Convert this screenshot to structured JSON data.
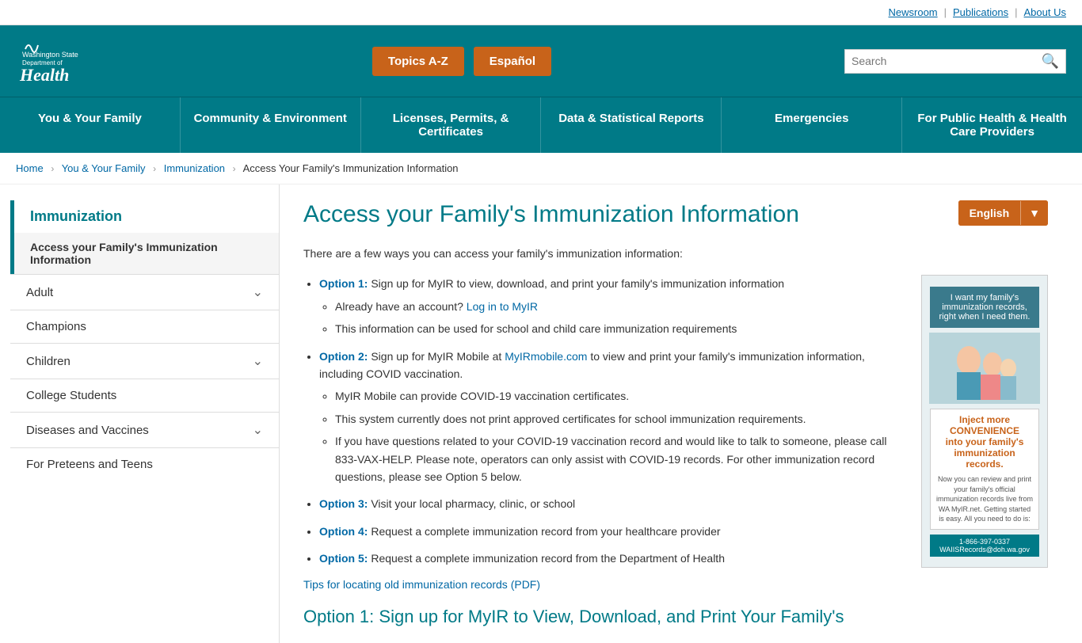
{
  "header": {
    "top_links": [
      {
        "label": "Newsroom",
        "id": "newsroom"
      },
      {
        "label": "Publications",
        "id": "publications"
      },
      {
        "label": "About Us",
        "id": "about-us"
      }
    ],
    "btn_topics": "Topics A-Z",
    "btn_espanol": "Español",
    "search_placeholder": "Search"
  },
  "nav": {
    "items": [
      {
        "label": "You & Your Family",
        "id": "you-your-family"
      },
      {
        "label": "Community & Environment",
        "id": "community-environment"
      },
      {
        "label": "Licenses, Permits, & Certificates",
        "id": "licenses-permits"
      },
      {
        "label": "Data & Statistical Reports",
        "id": "data-statistical"
      },
      {
        "label": "Emergencies",
        "id": "emergencies"
      },
      {
        "label": "For Public Health & Health Care Providers",
        "id": "public-health"
      }
    ]
  },
  "breadcrumb": {
    "items": [
      {
        "label": "Home",
        "id": "home"
      },
      {
        "label": "You & Your Family",
        "id": "you-your-family"
      },
      {
        "label": "Immunization",
        "id": "immunization"
      }
    ],
    "current": "Access Your Family's Immunization Information"
  },
  "sidebar": {
    "title": "Immunization",
    "active_item": "Access your Family's Immunization Information",
    "items": [
      {
        "label": "Adult",
        "has_chevron": true,
        "id": "adult"
      },
      {
        "label": "Champions",
        "has_chevron": false,
        "id": "champions"
      },
      {
        "label": "Children",
        "has_chevron": true,
        "id": "children"
      },
      {
        "label": "College Students",
        "has_chevron": false,
        "id": "college-students"
      },
      {
        "label": "Diseases and Vaccines",
        "has_chevron": true,
        "id": "diseases-vaccines"
      },
      {
        "label": "For Preteens and Teens",
        "has_chevron": false,
        "id": "preteens-teens"
      }
    ]
  },
  "main": {
    "page_title": "Access your Family's Immunization Information",
    "lang_button": "English",
    "intro": "There are a few ways you can access your family's immunization information:",
    "options": [
      {
        "label": "Option 1:",
        "text": " Sign up for MyIR to view, download, and print your family's immunization information",
        "sub_items": [
          {
            "text": "Already have an account? ",
            "link_label": "Log in to MyIR",
            "link": "#"
          },
          {
            "text": "This information can be used for school and child care immunization requirements"
          }
        ]
      },
      {
        "label": "Option 2:",
        "text": " Sign up for MyIR Mobile at ",
        "link_label": "MyIRmobile.com",
        "link": "#",
        "text2": " to view and print your family's immunization information, including COVID vaccination.",
        "sub_items": [
          {
            "text": "MyIR Mobile can provide COVID-19 vaccination certificates."
          },
          {
            "text": "This system currently does not print approved certificates for school immunization requirements."
          },
          {
            "text": "If you have questions related to your COVID-19 vaccination record and would like to talk to someone, please call 833-VAX-HELP. Please note, operators can only assist with COVID-19 records. For other immunization record questions, please see Option 5 below."
          }
        ]
      },
      {
        "label": "Option 3:",
        "text": " Visit your local pharmacy, clinic, or school"
      },
      {
        "label": "Option 4:",
        "text": " Request a complete immunization record from your healthcare provider"
      },
      {
        "label": "Option 5:",
        "text": " Request a complete immunization record from the Department of Health"
      }
    ],
    "tips_link": "Tips for locating old immunization records (PDF)",
    "section_heading": "Option 1: Sign up for MyIR to View, Download, and Print Your Family's"
  }
}
